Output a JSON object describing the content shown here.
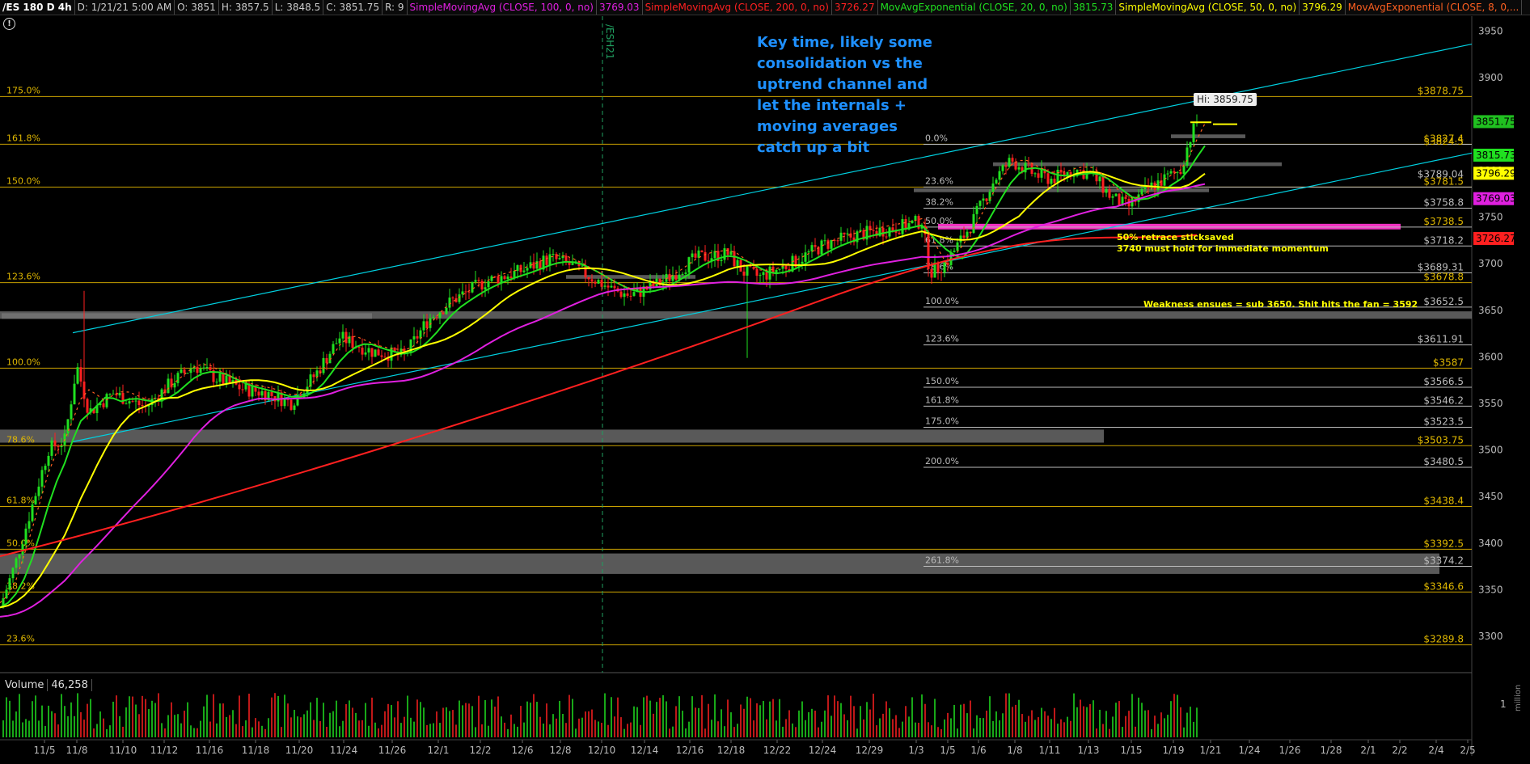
{
  "header": {
    "symbol": "/ES 180 D 4h",
    "date": "D: 1/21/21 5:00 AM",
    "open": "O: 3851",
    "high": "H: 3857.5",
    "low": "L: 3848.5",
    "close": "C: 3851.75",
    "range": "R: 9",
    "studies": [
      {
        "label": "SimpleMovingAvg (CLOSE, 100, 0, no)",
        "value": "3769.03",
        "color": "#e020e0"
      },
      {
        "label": "SimpleMovingAvg (CLOSE, 200, 0, no)",
        "value": "3726.27",
        "color": "#ff2020"
      },
      {
        "label": "MovAvgExponential (CLOSE, 20, 0, no)",
        "value": "3815.73",
        "color": "#20e020"
      },
      {
        "label": "SimpleMovingAvg (CLOSE, 50, 0, no)",
        "value": "3796.29",
        "color": "#ffff00"
      },
      {
        "label": "MovAvgExponential (CLOSE, 8, 0,...",
        "value": "",
        "color": "#ff6020"
      }
    ]
  },
  "contract_marker": "/ESH21",
  "annotations": {
    "key_time": "Key time, likely some consolidation vs the uptrend channel and let the internals + moving averages catch up a bit",
    "retrace_1": "50%  retrace sticksaved",
    "retrace_2": "3740 must hold for immediate momentum",
    "weakness": "Weakness ensues = sub 3650. Shit hits the fan = 3592",
    "hi_tag": "Hi: 3859.75"
  },
  "volume": {
    "label": "Volume",
    "value": "46,258",
    "axis_label": "1",
    "units": "million"
  },
  "chart_data": {
    "type": "candlestick",
    "ylim": [
      3260,
      3965
    ],
    "y_ticks": [
      3300,
      3350,
      3400,
      3450,
      3500,
      3550,
      3600,
      3650,
      3700,
      3750,
      3800,
      3850,
      3900,
      3950
    ],
    "x_ticks": [
      "11/5",
      "11/8",
      "11/10",
      "11/12",
      "11/16",
      "11/18",
      "11/20",
      "11/24",
      "11/26",
      "12/1",
      "12/2",
      "12/6",
      "12/8",
      "12/10",
      "12/14",
      "12/16",
      "12/18",
      "12/22",
      "12/24",
      "12/29",
      "1/3",
      "1/5",
      "1/6",
      "1/8",
      "1/11",
      "1/13",
      "1/15",
      "1/19",
      "1/21",
      "1/24",
      "1/26",
      "1/28",
      "2/1",
      "2/2",
      "2/4",
      "2/5"
    ],
    "left_fib": [
      {
        "label": "175.0%",
        "price": 3878.75
      },
      {
        "label": "161.8%",
        "price": 3827.5
      },
      {
        "label": "150.0%",
        "price": 3781.5
      },
      {
        "label": "123.6%",
        "price": 3678.8
      },
      {
        "label": "100.0%",
        "price": 3587
      },
      {
        "label": "78.6%",
        "price": 3503.75
      },
      {
        "label": "61.8%",
        "price": 3438.4
      },
      {
        "label": "50.0%",
        "price": 3392.5
      },
      {
        "label": "38.2%",
        "price": 3346.6
      },
      {
        "label": "23.6%",
        "price": 3289.8
      }
    ],
    "right_fib": [
      {
        "label": "0.0%",
        "price": 3827.4
      },
      {
        "label": "23.6%",
        "price": 3781.5
      },
      {
        "label": "38.2%",
        "price": 3758.8
      },
      {
        "label": "50.0%",
        "price": 3738.5
      },
      {
        "label": "61.8%",
        "price": 3718.2
      },
      {
        "label": "78.6%",
        "price": 3689.31
      },
      {
        "label": "100.0%",
        "price": 3652.5
      },
      {
        "label": "123.6%",
        "price": 3611.91
      },
      {
        "label": "150.0%",
        "price": 3566.5
      },
      {
        "label": "161.8%",
        "price": 3546.2
      },
      {
        "label": "175.0%",
        "price": 3523.5
      },
      {
        "label": "200.0%",
        "price": 3480.5
      },
      {
        "label": "261.8%",
        "price": 3374.2
      }
    ],
    "price_labels": [
      "$3878.75",
      "$3827.4",
      "$3824.5",
      "$3789.04",
      "$3781.5",
      "$3758.8",
      "$3738.5",
      "$3718.2",
      "$3689.31",
      "$3678.8",
      "$3652.5",
      "$3611.91",
      "$3587",
      "$3566.5",
      "$3546.2",
      "$3523.5",
      "$3503.75",
      "$3480.5",
      "$3438.4",
      "$3392.5",
      "$3374.2",
      "$3346.6",
      "$3289.8"
    ],
    "last_prices": [
      {
        "value": "3851.75",
        "color": "#20c020"
      },
      {
        "value": "3815.73",
        "color": "#20e020"
      },
      {
        "value": "3796.29",
        "color": "#ffff00"
      },
      {
        "value": "3769.03",
        "color": "#e020e0"
      },
      {
        "value": "3726.27",
        "color": "#ff2020"
      }
    ],
    "hi": 3859.75
  }
}
